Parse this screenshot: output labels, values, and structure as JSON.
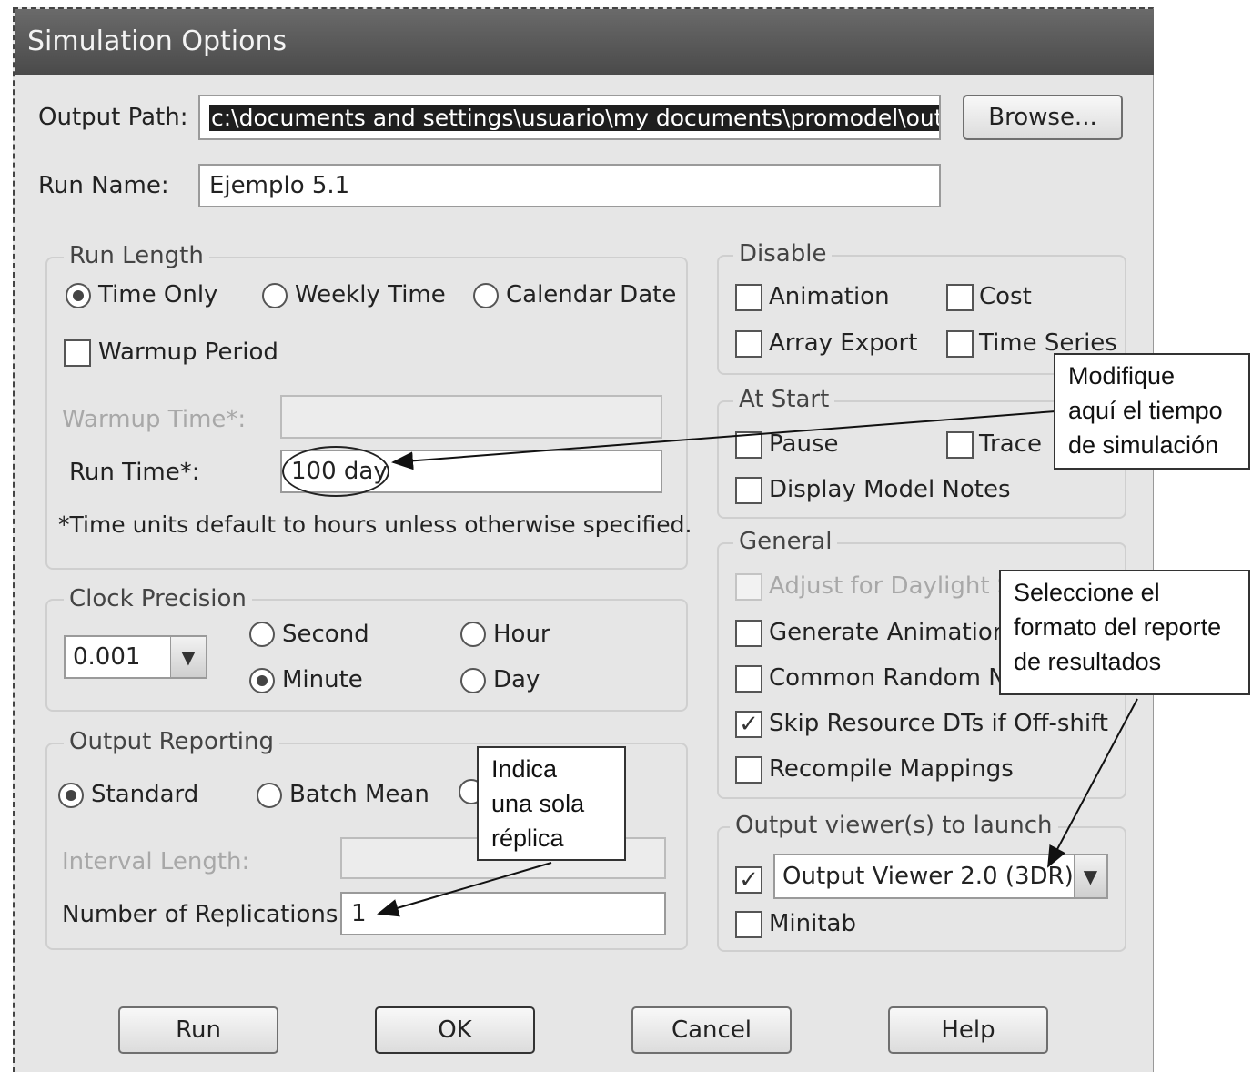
{
  "window": {
    "title": "Simulation Options"
  },
  "output_path": {
    "label": "Output Path:",
    "value": "c:\\documents and settings\\usuario\\my documents\\promodel\\output",
    "browse_label": "Browse..."
  },
  "run_name": {
    "label": "Run Name:",
    "value": "Ejemplo 5.1"
  },
  "run_length": {
    "legend": "Run Length",
    "time_only": "Time Only",
    "weekly_time": "Weekly Time",
    "calendar_date": "Calendar Date",
    "warmup_period": "Warmup Period",
    "warmup_time_label": "Warmup Time*:",
    "run_time_label": "Run Time*:",
    "run_time_value": "100 day",
    "footnote": "*Time units default to hours unless otherwise specified."
  },
  "clock_precision": {
    "legend": "Clock Precision",
    "value": "0.001",
    "second": "Second",
    "hour": "Hour",
    "minute": "Minute",
    "day": "Day"
  },
  "output_reporting": {
    "legend": "Output Reporting",
    "standard": "Standard",
    "batch_mean": "Batch Mean",
    "interval_length_label": "Interval Length:",
    "replications_label": "Number of Replications:",
    "replications_value": "1"
  },
  "disable": {
    "legend": "Disable",
    "animation": "Animation",
    "cost": "Cost",
    "array_export": "Array Export",
    "time_series": "Time Series"
  },
  "at_start": {
    "legend": "At Start",
    "pause": "Pause",
    "trace": "Trace",
    "display_model_notes": "Display Model Notes"
  },
  "general": {
    "legend": "General",
    "adjust_daylight": "Adjust for Daylight Sa",
    "generate_animation": "Generate Animation S",
    "common_random": "Common Random Num",
    "skip_resource": "Skip Resource DTs if Off-shift",
    "recompile": "Recompile Mappings"
  },
  "output_viewers": {
    "legend": "Output viewer(s) to launch",
    "viewer_value": "Output Viewer 2.0 (3DR)",
    "minitab": "Minitab"
  },
  "buttons": {
    "run": "Run",
    "ok": "OK",
    "cancel": "Cancel",
    "help": "Help"
  },
  "annotations": {
    "run_time_note": [
      "Modifique",
      "aquí el tiempo",
      "de simulación"
    ],
    "report_note": [
      "Seleccione el",
      "formato del reporte",
      "de resultados"
    ],
    "replication_note": [
      "Indica",
      "una sola",
      "réplica"
    ]
  }
}
